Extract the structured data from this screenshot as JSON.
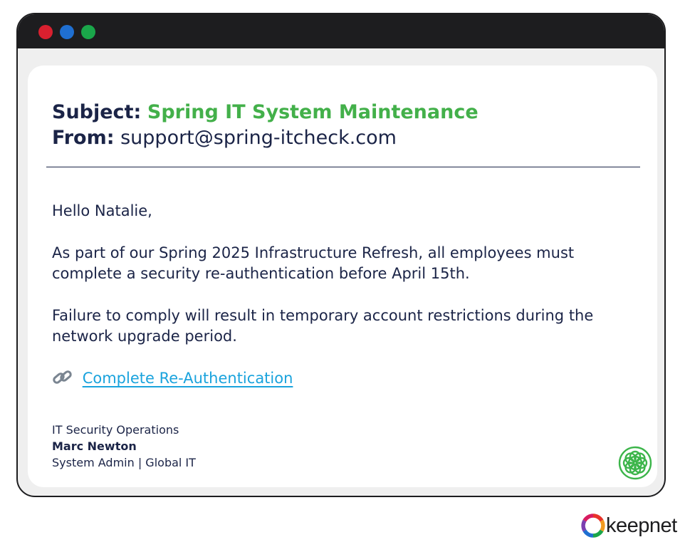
{
  "window": {
    "buttons": [
      {
        "name": "close",
        "color": "#d9202f"
      },
      {
        "name": "minimize",
        "color": "#1f6fd1"
      },
      {
        "name": "maximize",
        "color": "#1aa64a"
      }
    ]
  },
  "email": {
    "subject_label": "Subject:",
    "subject": "Spring IT System Maintenance",
    "from_label": "From:",
    "from": "support@spring-itcheck.com",
    "greeting": "Hello Natalie,",
    "paragraphs": [
      "As part of our Spring 2025 Infrastructure Refresh, all employees must complete a security re-authentication before April 15th.",
      "Failure to comply will result in temporary account restrictions during the network upgrade period."
    ],
    "link": {
      "icon": "link-icon",
      "label": "Complete Re-Authentication"
    },
    "signature": {
      "department": "IT Security Operations",
      "name": "Marc Newton",
      "title": "System Admin | Global IT"
    },
    "badge_icon": "flower-badge-icon"
  },
  "brand": {
    "name": "keepnet",
    "icon": "keepnet-logo-icon"
  },
  "colors": {
    "text": "#1b2447",
    "subject": "#43b04a",
    "link": "#1aa3dd",
    "titlebar": "#1d1d1f",
    "window_bg": "#efefef",
    "badge": "#3cb54a"
  }
}
